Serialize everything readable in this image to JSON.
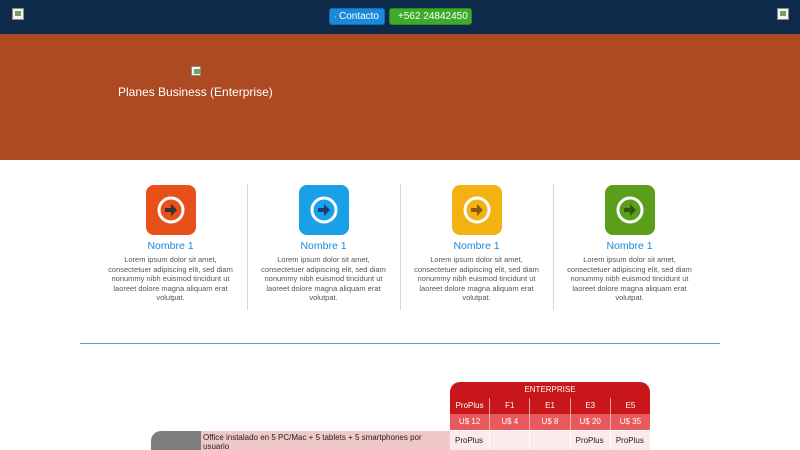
{
  "header": {
    "contact_label": "Contacto",
    "phone_label": "+562 24842450",
    "contact_icon": "envelope-icon",
    "phone_icon": "phone-icon"
  },
  "hero": {
    "title": "Planes Business (Enterprise)",
    "background_color": "#ad4a22"
  },
  "features": [
    {
      "title": "Nombre 1",
      "text": "Lorem ipsum dolor sit amet, consectetuer adipiscing elit, sed diam nonummy nibh euismod tincidunt ut laoreet dolore magna aliquam erat volutpat.",
      "icon": "arrow-right-circle-icon",
      "color": "#e8501a"
    },
    {
      "title": "Nombre 1",
      "text": "Lorem ipsum dolor sit amet, consectetuer adipiscing elit, sed diam nonummy nibh euismod tincidunt ut laoreet dolore magna aliquam erat volutpat.",
      "icon": "arrow-right-circle-icon",
      "color": "#18a0e8"
    },
    {
      "title": "Nombre 1",
      "text": "Lorem ipsum dolor sit amet, consectetuer adipiscing elit, sed diam nonummy nibh euismod tincidunt ut laoreet dolore magna aliquam erat volutpat.",
      "icon": "arrow-right-circle-icon",
      "color": "#f3b212"
    },
    {
      "title": "Nombre 1",
      "text": "Lorem ipsum dolor sit amet, consectetuer adipiscing elit, sed diam nonummy nibh euismod tincidunt ut laoreet dolore magna aliquam erat volutpat.",
      "icon": "arrow-right-circle-icon",
      "color": "#5a9e1c"
    }
  ],
  "plans": {
    "group_title": "ENTERPRISE",
    "columns": [
      "ProPlus",
      "F1",
      "E1",
      "E3",
      "E5"
    ],
    "prices": [
      "U$ 12",
      "U$ 4",
      "U$ 8",
      "U$ 20",
      "U$ 35"
    ],
    "rows": [
      {
        "description": "Office instalado en 5 PC/Mac + 5 tablets + 5 smartphones por usuario",
        "cells": [
          "ProPlus",
          "",
          "",
          "ProPlus",
          "ProPlus"
        ]
      }
    ]
  }
}
